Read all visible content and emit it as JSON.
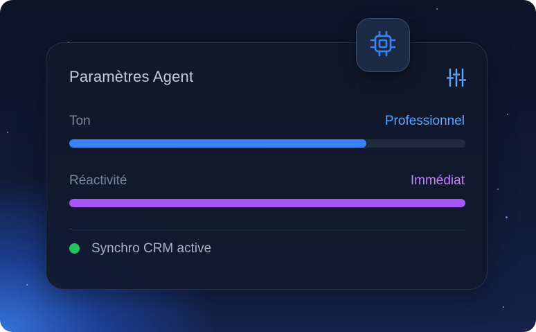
{
  "card": {
    "title": "Paramètres Agent",
    "chip_icon": "cpu-chip-icon",
    "settings_icon": "sliders-icon"
  },
  "settings": [
    {
      "label": "Ton",
      "value": "Professionnel",
      "value_color": "#60a5fa",
      "fill_color": "#3b82f6",
      "level_percent": 75
    },
    {
      "label": "Réactivité",
      "value": "Immédiat",
      "value_color": "#c084fc",
      "fill_color": "#a855f7",
      "level_percent": 100
    }
  ],
  "status": {
    "text": "Synchro CRM active",
    "dot_color": "#22c55e"
  },
  "colors": {
    "accent_blue": "#60a5fa",
    "accent_purple": "#a855f7"
  }
}
